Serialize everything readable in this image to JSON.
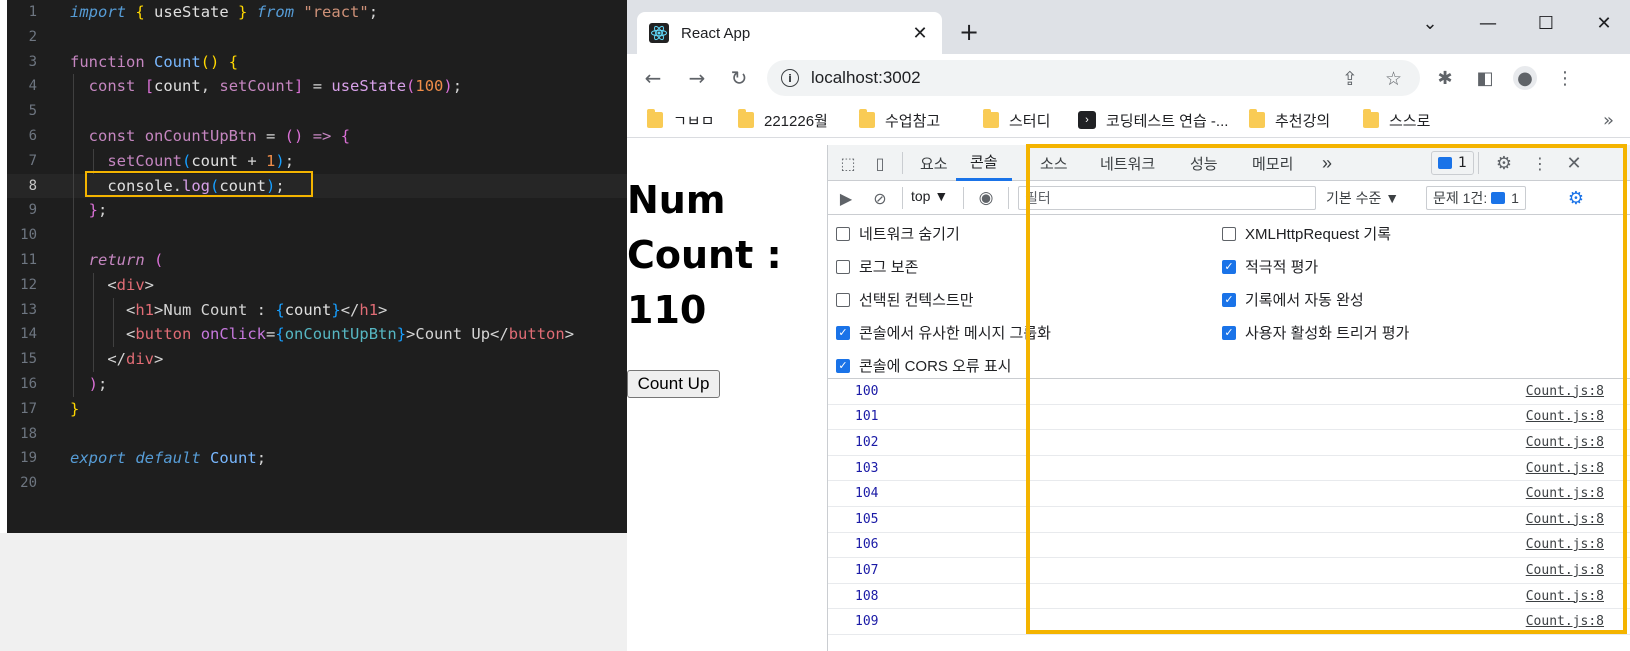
{
  "editor": {
    "line_numbers": [
      "1",
      "2",
      "3",
      "4",
      "5",
      "6",
      "7",
      "8",
      "9",
      "10",
      "11",
      "12",
      "13",
      "14",
      "15",
      "16",
      "17",
      "18",
      "19",
      "20"
    ]
  },
  "browser": {
    "tab_title": "React App",
    "url": "localhost:3002",
    "bookmarks": [
      "ㄱㅂㅁ",
      "221226월",
      "수업참고",
      "스터디",
      "코딩테스트 연습 -...",
      "추천강의",
      "스스로"
    ],
    "page": {
      "heading": "Num Count : 110",
      "button_label": "Count Up"
    }
  },
  "devtools": {
    "tabs": [
      "요소",
      "콘솔",
      "소스",
      "네트워크",
      "성능",
      "메모리"
    ],
    "active_tab": "콘솔",
    "issue_count": "1",
    "context": "top",
    "filter_placeholder": "필터",
    "level": "기본 수준",
    "issues_label": "문제 1건:",
    "issues_count2": "1",
    "settings_left": [
      {
        "label": "네트워크 숨기기",
        "checked": false
      },
      {
        "label": "로그 보존",
        "checked": false
      },
      {
        "label": "선택된 컨텍스트만",
        "checked": false
      },
      {
        "label": "콘솔에서 유사한 메시지 그룹화",
        "checked": true
      },
      {
        "label": "콘솔에 CORS 오류 표시",
        "checked": true
      }
    ],
    "settings_right": [
      {
        "label": "XMLHttpRequest 기록",
        "checked": false
      },
      {
        "label": "적극적 평가",
        "checked": true
      },
      {
        "label": "기록에서 자동 완성",
        "checked": true
      },
      {
        "label": "사용자 활성화 트리거 평가",
        "checked": true
      }
    ],
    "console_rows": [
      {
        "value": "100",
        "source": "Count.js:8"
      },
      {
        "value": "101",
        "source": "Count.js:8"
      },
      {
        "value": "102",
        "source": "Count.js:8"
      },
      {
        "value": "103",
        "source": "Count.js:8"
      },
      {
        "value": "104",
        "source": "Count.js:8"
      },
      {
        "value": "105",
        "source": "Count.js:8"
      },
      {
        "value": "106",
        "source": "Count.js:8"
      },
      {
        "value": "107",
        "source": "Count.js:8"
      },
      {
        "value": "108",
        "source": "Count.js:8"
      },
      {
        "value": "109",
        "source": "Count.js:8"
      }
    ]
  },
  "colors": {
    "highlight": "#f4b400",
    "editor_bg": "#1e1e1e",
    "devtools_accent": "#1a73e8"
  }
}
